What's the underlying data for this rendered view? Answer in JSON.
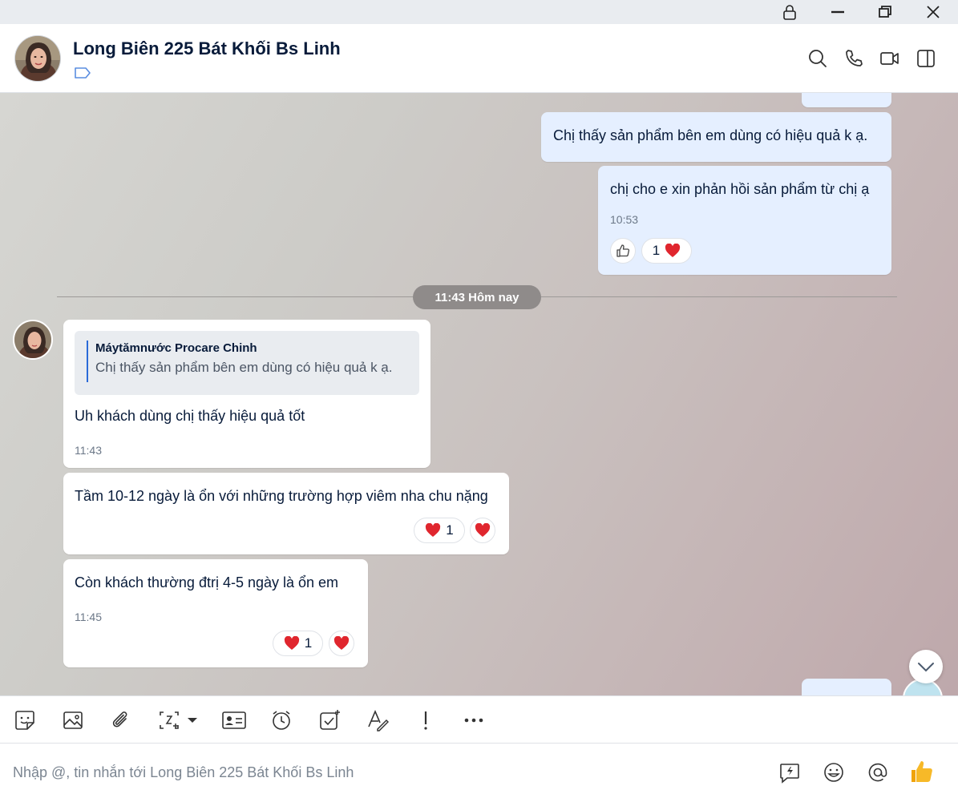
{
  "window": {
    "controls": [
      "lock-icon",
      "minimize-icon",
      "restore-icon",
      "close-icon"
    ]
  },
  "header": {
    "title": "Long Biên 225 Bát Khối Bs Linh",
    "actions": [
      "search-icon",
      "phone-icon",
      "video-call-icon",
      "side-panel-icon"
    ]
  },
  "messages": {
    "out1": {
      "text": "Chị thấy sản phẩm bên em dùng có hiệu quả k ạ."
    },
    "out2": {
      "text": "chị cho e xin phản hồi sản phẩm từ chị ạ",
      "time": "10:53",
      "reaction_count": "1"
    },
    "divider": {
      "label": "11:43 Hôm nay"
    },
    "in1": {
      "quote_author": "Máytămnước Procare Chinh",
      "quote_text": "Chị thấy sản phẩm bên em dùng có hiệu quả k ạ.",
      "text": "Uh khách dùng chị thấy hiệu quả tốt",
      "time": "11:43"
    },
    "in2": {
      "text": "Tầm 10-12 ngày là ổn với những trường hợp viêm nha chu nặng",
      "reaction_count": "1"
    },
    "in3": {
      "text": "Còn khách thường đtrị 4-5 ngày là ổn em",
      "time": "11:45",
      "reaction_count": "1"
    }
  },
  "toolbar": {
    "tools": [
      "sticker-icon",
      "image-icon",
      "attachment-icon",
      "screenshot-icon",
      "contact-card-icon",
      "reminder-icon",
      "task-icon",
      "text-format-icon",
      "urgent-icon",
      "more-icon"
    ]
  },
  "composer": {
    "placeholder": "Nhập @, tin nhắn tới Long Biên 225 Bát Khối Bs Linh",
    "actions": [
      "quick-reply-icon",
      "emoji-icon",
      "mention-icon",
      "thumbs-up-icon"
    ]
  },
  "colors": {
    "accent": "#2a6ad8",
    "outgoing_bubble": "#e5efff",
    "heart": "#e0262e"
  }
}
